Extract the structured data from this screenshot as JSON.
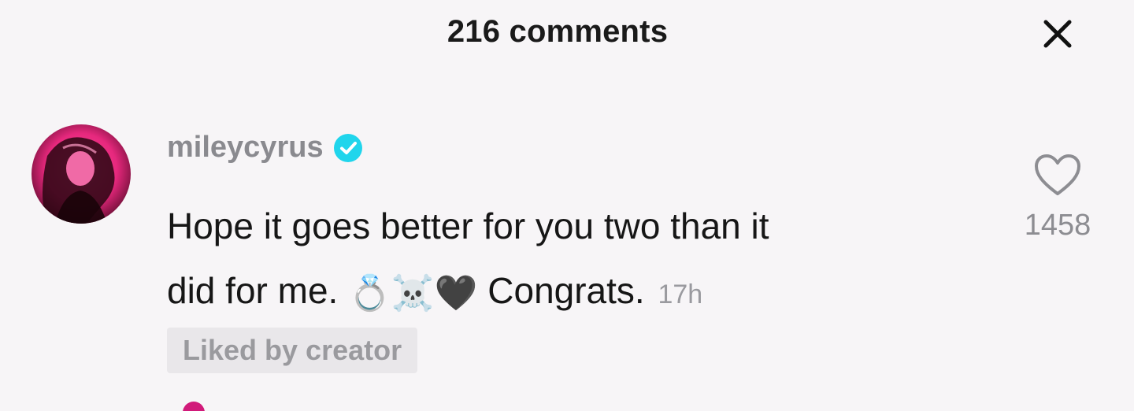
{
  "header": {
    "title": "216 comments",
    "close_icon": "close-icon"
  },
  "comment": {
    "username": "mileycyrus",
    "verified_icon": "verified-badge-icon",
    "text_line1": "Hope it goes better for you two than it",
    "text_line2": "did for me.",
    "emojis": [
      "💍",
      "☠️",
      "🖤"
    ],
    "text_after": "Congrats.",
    "timestamp": "17h",
    "liked_badge": "Liked by creator",
    "like_icon": "heart-outline-icon",
    "like_count": "1458"
  },
  "colors": {
    "background": "#f7f5f7",
    "verified": "#20d5ec",
    "avatar_tint": "#e6287d"
  }
}
